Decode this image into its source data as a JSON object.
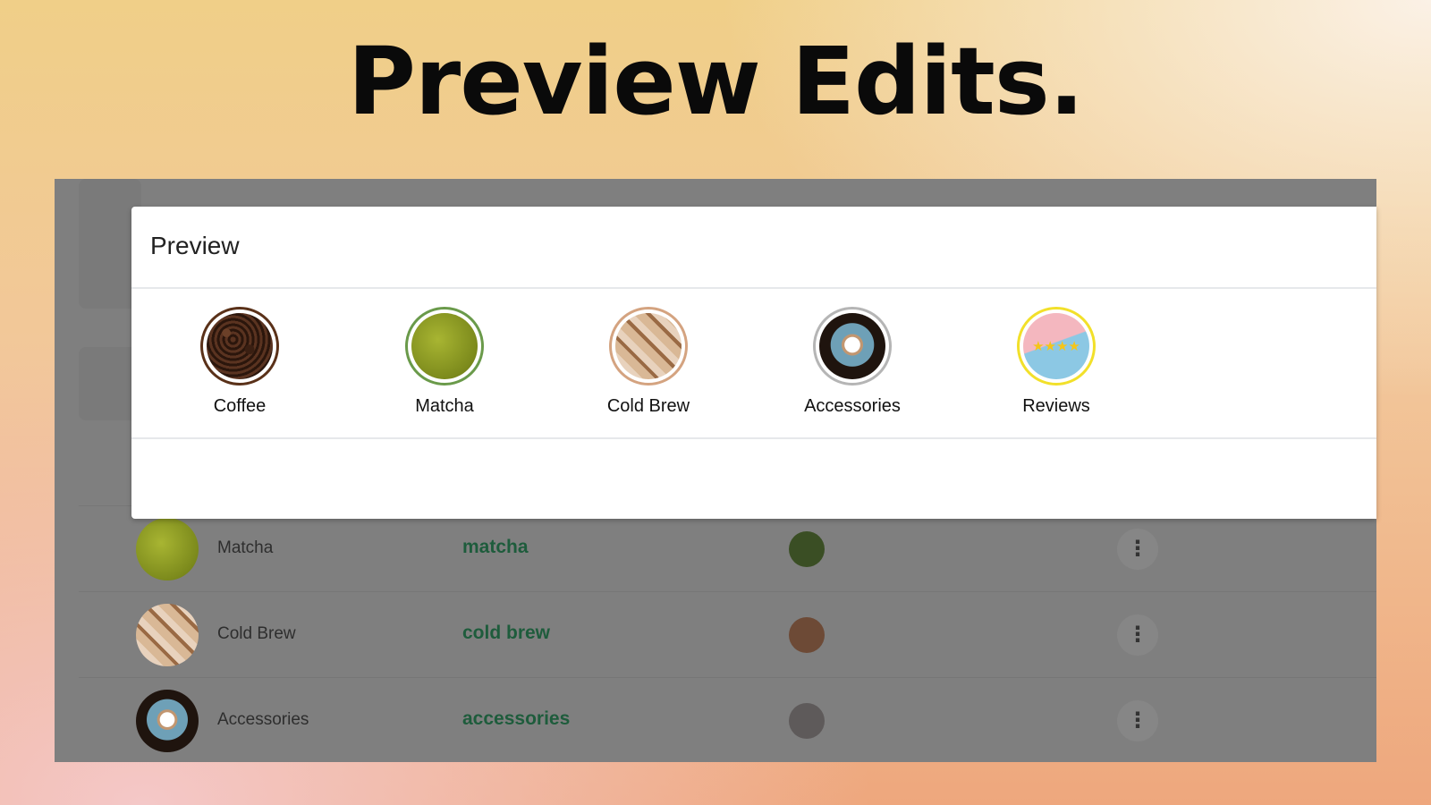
{
  "hero": {
    "title": "Preview Edits."
  },
  "modal": {
    "title": "Preview",
    "categories": [
      {
        "label": "Coffee",
        "ring_color": "#5a3119",
        "image": "coffee-beans"
      },
      {
        "label": "Matcha",
        "ring_color": "#6a9a4a",
        "image": "matcha-powder"
      },
      {
        "label": "Cold Brew",
        "ring_color": "#d4a380",
        "image": "iced-coffee"
      },
      {
        "label": "Accessories",
        "ring_color": "#b5b5b5",
        "image": "coffee-cup"
      },
      {
        "label": "Reviews",
        "ring_color": "#f2e02a",
        "image": "stars"
      }
    ]
  },
  "table": {
    "rows": [
      {
        "name": "Matcha",
        "slug": "matcha",
        "color": "#3a4e24",
        "image": "matcha-powder"
      },
      {
        "name": "Cold Brew",
        "slug": "cold brew",
        "color": "#6d4a36",
        "image": "iced-coffee"
      },
      {
        "name": "Accessories",
        "slug": "accessories",
        "color": "#5e5a5a",
        "image": "coffee-cup"
      }
    ],
    "menu_icon": "more-vertical-icon"
  }
}
